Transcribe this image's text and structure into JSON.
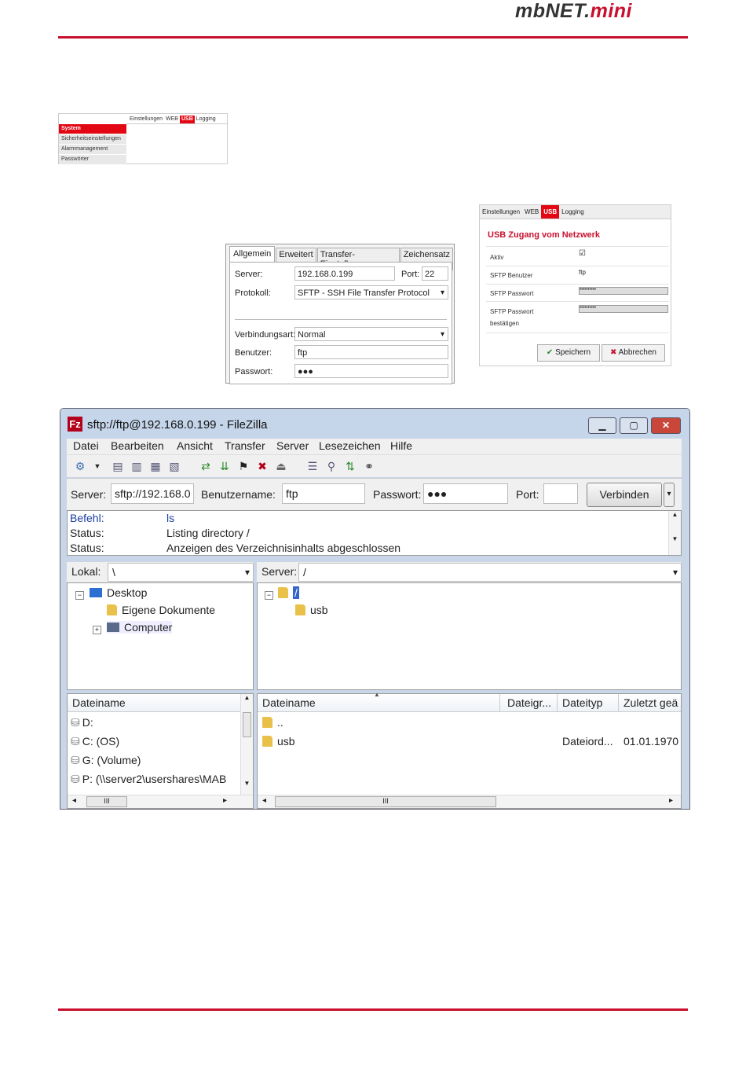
{
  "header": {
    "brand_prefix": "mbNET.",
    "brand_suffix": "mini"
  },
  "mini_nav": {
    "tabs": [
      "Einstellungen",
      "WEB",
      "USB",
      "Logging"
    ],
    "menu": [
      "System",
      "Sicherheitseinstellungen",
      "Alarmmanagement",
      "Passwörter"
    ]
  },
  "site_dialog": {
    "tabs": [
      "Allgemein",
      "Erweitert",
      "Transfer-Einstellungen",
      "Zeichensatz"
    ],
    "server_label": "Server:",
    "server_value": "192.168.0.199",
    "port_label": "Port:",
    "port_value": "22",
    "protocol_label": "Protokoll:",
    "protocol_value": "SFTP - SSH File Transfer Protocol",
    "conn_label": "Verbindungsart:",
    "conn_value": "Normal",
    "user_label": "Benutzer:",
    "user_value": "ftp",
    "pass_label": "Passwort:",
    "pass_value": "●●●"
  },
  "usb_panel": {
    "tabs": [
      "Einstellungen",
      "WEB",
      "USB",
      "Logging"
    ],
    "title": "USB Zugang vom Netzwerk",
    "rows": {
      "active_label": "Aktiv",
      "active_value": "☑",
      "user_label": "SFTP Benutzer",
      "user_value": "ftp",
      "pass_label": "SFTP Passwort",
      "pass_value": "••••••••••",
      "pass2_label_1": "SFTP Passwort",
      "pass2_label_2": "bestätigen",
      "pass2_value": "••••••••••"
    },
    "save_button": "Speichern",
    "cancel_button": "Abbrechen"
  },
  "filezilla": {
    "window_title": "sftp://ftp@192.168.0.199 - FileZilla",
    "logo": "Fz",
    "menu": [
      "Datei",
      "Bearbeiten",
      "Ansicht",
      "Transfer",
      "Server",
      "Lesezeichen",
      "Hilfe"
    ],
    "quickconnect": {
      "server_label": "Server:",
      "server_value": "sftp://192.168.0",
      "user_label": "Benutzername:",
      "user_value": "ftp",
      "pass_label": "Passwort:",
      "pass_value": "●●●",
      "port_label": "Port:",
      "port_value": "",
      "connect_label": "Verbinden"
    },
    "log": [
      {
        "type": "Befehl:",
        "msg": "ls"
      },
      {
        "type": "Status:",
        "msg": "Listing directory /"
      },
      {
        "type": "Status:",
        "msg": "Anzeigen des Verzeichnisinhalts abgeschlossen"
      }
    ],
    "local": {
      "path_label": "Lokal:",
      "path_value": "\\",
      "tree": [
        "Desktop",
        "Eigene Dokumente",
        "Computer"
      ],
      "list_header": "Dateiname",
      "files": [
        "D:",
        "C: (OS)",
        "G: (Volume)",
        "P: (\\\\server2\\usershares\\MAB"
      ]
    },
    "remote": {
      "path_label": "Server:",
      "path_value": "/",
      "tree_root": "/",
      "tree_child": "usb",
      "headers": [
        "Dateiname",
        "Dateigr...",
        "Dateityp",
        "Zuletzt geä"
      ],
      "rows": [
        {
          "name": "..",
          "size": "",
          "type": "",
          "modified": ""
        },
        {
          "name": "usb",
          "size": "",
          "type": "Dateiord...",
          "modified": "01.01.1970"
        }
      ]
    },
    "scroll_thumb": "III"
  }
}
